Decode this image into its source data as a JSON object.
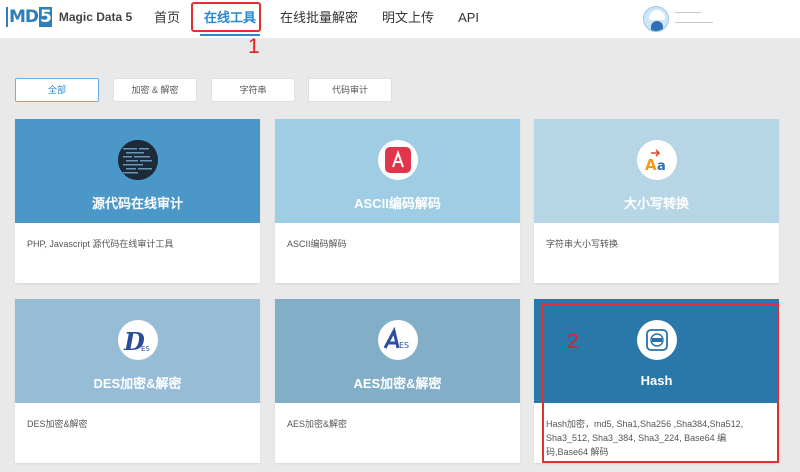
{
  "header": {
    "logo_mark": "MD5",
    "logo_text": "Magic Data 5",
    "nav": [
      {
        "label": "首页"
      },
      {
        "label": "在线工具"
      },
      {
        "label": "在线批量解密"
      },
      {
        "label": "明文上传"
      },
      {
        "label": "API"
      }
    ],
    "active_nav": "在线工具"
  },
  "annotations": {
    "one": "1",
    "two": "2"
  },
  "filter_tabs": [
    {
      "label": "全部"
    },
    {
      "label": "加密 & 解密"
    },
    {
      "label": "字符串"
    },
    {
      "label": "代码审计"
    }
  ],
  "active_tab": "全部",
  "cards": [
    {
      "title": "源代码在线审计",
      "desc": "PHP, Javascript 源代码在线审计工具",
      "color": "#4b98c8",
      "icon": "code-audit-icon"
    },
    {
      "title": "ASCII编码解码",
      "desc": "ASCII编码解码",
      "color": "#9fcde4",
      "icon": "ascii-icon"
    },
    {
      "title": "大小写转换",
      "desc": "字符串大小写转换",
      "color": "#b7d6e5",
      "icon": "case-convert-icon"
    },
    {
      "title": "DES加密&解密",
      "desc": "DES加密&解密",
      "color": "#96bcd6",
      "icon": "des-icon"
    },
    {
      "title": "AES加密&解密",
      "desc": "AES加密&解密",
      "color": "#82aec7",
      "icon": "aes-icon"
    },
    {
      "title": "Hash",
      "desc": "Hash加密，md5, Sha1,Sha256 ,Sha384,Sha512, Sha3_512, Sha3_384, Sha3_224, Base64 编码,Base64 解码",
      "color": "#2a78a9",
      "icon": "hash-icon"
    }
  ],
  "colors": {
    "accent": "#2c88cc",
    "annotation_red": "#e03030"
  }
}
